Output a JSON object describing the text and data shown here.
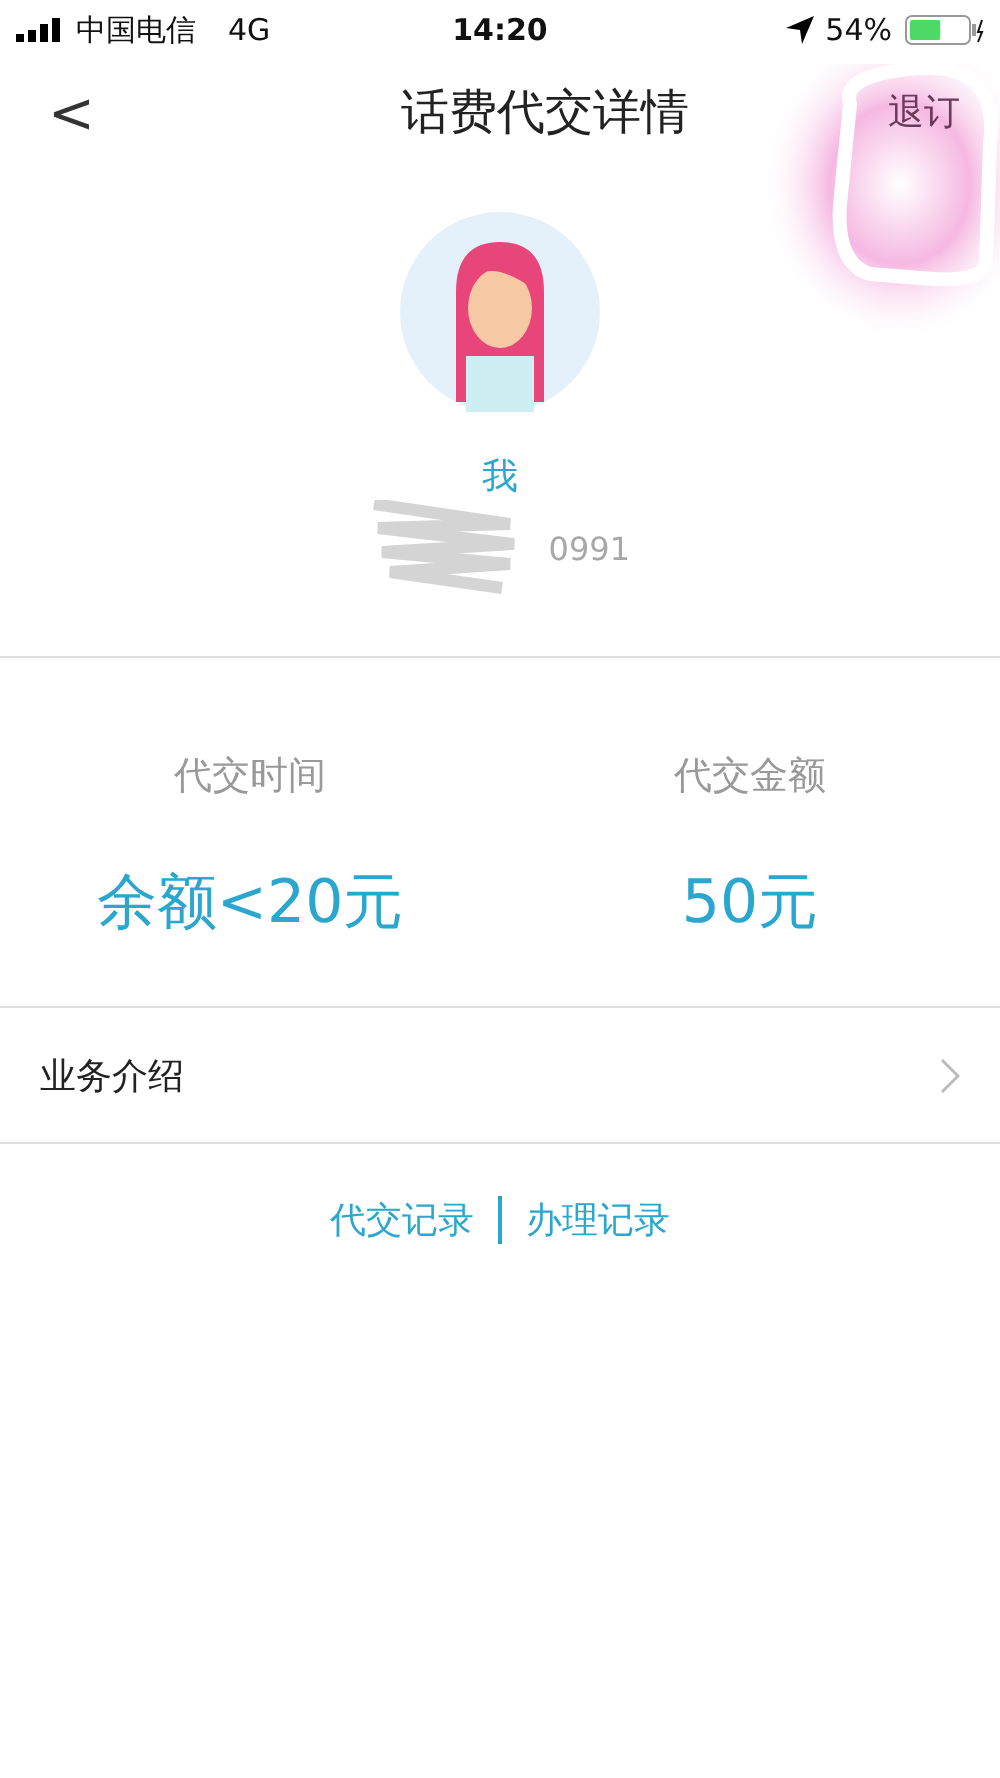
{
  "status_bar": {
    "carrier": "中国电信",
    "network": "4G",
    "time": "14:20",
    "battery_text": "54%",
    "battery": {
      "level": 0.54
    }
  },
  "nav": {
    "back": "<",
    "title": "话费代交详情",
    "action": "退订"
  },
  "profile": {
    "name": "我",
    "phone": "0991"
  },
  "summary": [
    {
      "label": "代交时间",
      "value": "余额<20元"
    },
    {
      "label": "代交金额",
      "value": "50元"
    }
  ],
  "menu": [
    {
      "label": "业务介绍"
    }
  ],
  "links": [
    "代交记录",
    "办理记录"
  ]
}
